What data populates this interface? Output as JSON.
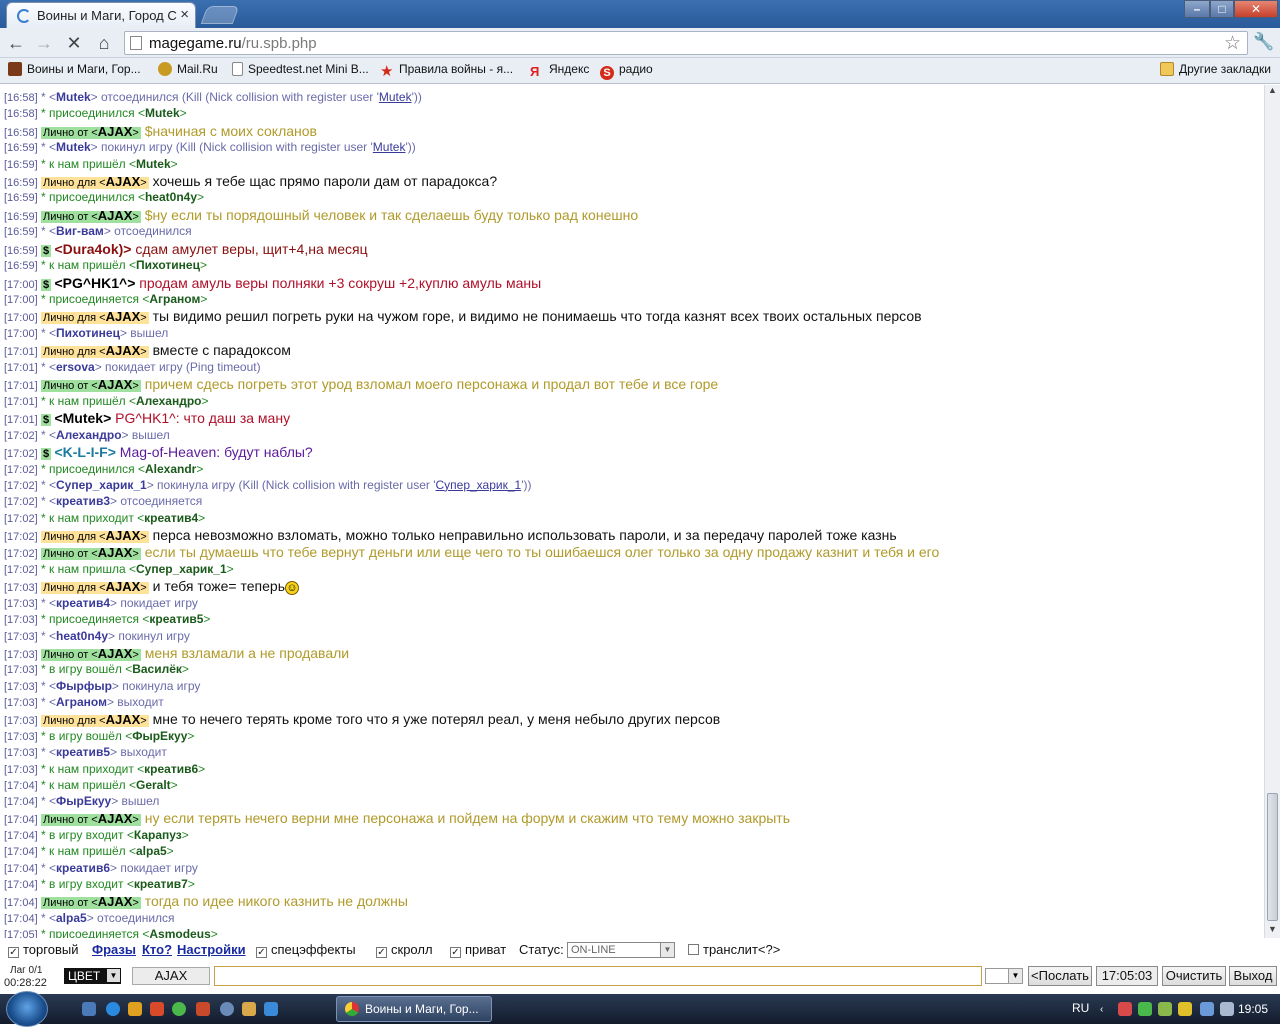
{
  "browser": {
    "tab_title": "Воины и Маги, Город Св",
    "url_domain": "magegame.ru",
    "url_path": "/ru.spb.php",
    "bookmarks": [
      {
        "label": "Воины и Маги, Гор...",
        "icon": "game-icon",
        "color": "#7a3a1a"
      },
      {
        "label": "Mail.Ru",
        "icon": "mailru-icon",
        "color": "#c89a22"
      },
      {
        "label": "Speedtest.net Mini B...",
        "icon": "page-icon",
        "color": "#ffffff"
      },
      {
        "label": "Правила войны - я...",
        "icon": "star-icon",
        "color": "#d42a1a"
      },
      {
        "label": "Яндекс",
        "icon": "yandex-icon",
        "color": "#e02020"
      },
      {
        "label": "радио",
        "icon": "radio-icon",
        "color": "#d42a1a"
      }
    ],
    "other_bookmarks": "Другие закладки"
  },
  "chat": [
    {
      "time": "[16:58]",
      "type": "leave",
      "pre": "* <",
      "nick": "Mutek",
      "post": "> отсоединился (Kill (Nick collision with register user '",
      "link": "Mutek",
      "end": "'))"
    },
    {
      "time": "[16:58]",
      "type": "sys",
      "pre": "* присоединился <",
      "nick": "Mutek",
      "post": ">"
    },
    {
      "time": "[16:58]",
      "type": "priv-from",
      "label": "Лично от <",
      "nick": "AJAX",
      "label_end": ">",
      "msg": " $начиная с моих сокланов"
    },
    {
      "time": "[16:59]",
      "type": "leave",
      "pre": "* <",
      "nick": "Mutek",
      "post": "> покинул игру (Kill (Nick collision with register user '",
      "link": "Mutek",
      "end": "'))"
    },
    {
      "time": "[16:59]",
      "type": "sys",
      "pre": "* к нам пришёл <",
      "nick": "Mutek",
      "post": ">"
    },
    {
      "time": "[16:59]",
      "type": "priv-to",
      "label": "Лично для <",
      "nick": "AJAX",
      "label_end": ">",
      "msg": " хочешь я тебе щас прямо пароли дам от парадокса?"
    },
    {
      "time": "[16:59]",
      "type": "sys",
      "pre": "* присоединился <",
      "nick": "heat0n4y",
      "post": ">"
    },
    {
      "time": "[16:59]",
      "type": "priv-from",
      "label": "Лично от <",
      "nick": "AJAX",
      "label_end": ">",
      "msg": " $ну если ты порядошный человек и так сделаешь буду только рад конешно"
    },
    {
      "time": "[16:59]",
      "type": "leave",
      "pre": "* <",
      "nick": "Виг-вам",
      "post": "> отсоединился"
    },
    {
      "time": "[16:59]",
      "type": "trade",
      "nick": "<Dura4ok)>",
      "nick_color": "#8a1010",
      "msg": " сдам амулет веры, щит+4,на месяц",
      "msg_color": "#8a1010"
    },
    {
      "time": "[16:59]",
      "type": "sys",
      "pre": "* к нам пришёл <",
      "nick": "Пихотинец",
      "post": ">"
    },
    {
      "time": "[17:00]",
      "type": "trade",
      "nick": "<PG^HK1^>",
      "nick_color": "#000000",
      "msg": " продам амуль веры полняки +3 сокруш +2,куплю амуль маны",
      "msg_color": "#b0102a"
    },
    {
      "time": "[17:00]",
      "type": "sys",
      "pre": "* присоединяется <",
      "nick": "Аграном",
      "post": ">"
    },
    {
      "time": "[17:00]",
      "type": "priv-to",
      "label": "Лично для <",
      "nick": "AJAX",
      "label_end": ">",
      "msg": " ты видимо решил погреть руки на чужом горе, и видимо не понимаешь что тогда казнят всех твоих остальных персов"
    },
    {
      "time": "[17:00]",
      "type": "leave",
      "pre": "* <",
      "nick": "Пихотинец",
      "post": "> вышел"
    },
    {
      "time": "[17:01]",
      "type": "priv-to",
      "label": "Лично для <",
      "nick": "AJAX",
      "label_end": ">",
      "msg": " вместе с парадоксом"
    },
    {
      "time": "[17:01]",
      "type": "leave",
      "pre": "* <",
      "nick": "ersova",
      "post": "> покидает игру (Ping timeout)"
    },
    {
      "time": "[17:01]",
      "type": "priv-from",
      "label": "Лично от <",
      "nick": "AJAX",
      "label_end": ">",
      "msg": " причем сдесь погреть этот урод взломал моего персонажа и продал вот тебе и все горе"
    },
    {
      "time": "[17:01]",
      "type": "sys",
      "pre": "* к нам пришёл <",
      "nick": "Алехандро",
      "post": ">"
    },
    {
      "time": "[17:01]",
      "type": "trade",
      "nick": "<Mutek>",
      "nick_color": "#000000",
      "msg": " PG^HK1^: что даш за ману",
      "msg_color": "#b0102a"
    },
    {
      "time": "[17:02]",
      "type": "leave",
      "pre": "* <",
      "nick": "Алехандро",
      "post": "> вышел"
    },
    {
      "time": "[17:02]",
      "type": "trade",
      "nick": "<K-L-I-F>",
      "nick_color": "#1a7aa0",
      "msg": " Mag-of-Heaven: будут наблы?",
      "msg_color": "#5a1a9a"
    },
    {
      "time": "[17:02]",
      "type": "sys",
      "pre": "* присоединился <",
      "nick": "Alexandr",
      "post": ">"
    },
    {
      "time": "[17:02]",
      "type": "leave",
      "pre": "* <",
      "nick": "Супер_харик_1",
      "post": "> покинула игру (Kill (Nick collision with register user '",
      "link": "Супер_харик_1",
      "end": "'))"
    },
    {
      "time": "[17:02]",
      "type": "leave",
      "pre": "* <",
      "nick": "креатив3",
      "post": "> отсоединяется"
    },
    {
      "time": "[17:02]",
      "type": "sys",
      "pre": "* к нам приходит <",
      "nick": "креатив4",
      "post": ">"
    },
    {
      "time": "[17:02]",
      "type": "priv-to",
      "label": "Лично для <",
      "nick": "AJAX",
      "label_end": ">",
      "msg": " перса невозможно взломать, можно только неправильно использовать пароли, и за передачу паролей тоже казнь"
    },
    {
      "time": "[17:02]",
      "type": "priv-from",
      "label": "Лично от <",
      "nick": "AJAX",
      "label_end": ">",
      "msg": " если ты думаешь что тебе вернут деньги или еще чего то ты ошибаешся олег только за одну продажу казнит и тебя и его"
    },
    {
      "time": "[17:02]",
      "type": "sys",
      "pre": "* к нам пришла <",
      "nick": "Супер_харик_1",
      "post": ">"
    },
    {
      "time": "[17:03]",
      "type": "priv-to",
      "label": "Лично для <",
      "nick": "AJAX",
      "label_end": ">",
      "msg": " и тебя тоже= теперь",
      "smiley": true
    },
    {
      "time": "[17:03]",
      "type": "leave",
      "pre": "* <",
      "nick": "креатив4",
      "post": "> покидает игру"
    },
    {
      "time": "[17:03]",
      "type": "sys",
      "pre": "* присоединяется <",
      "nick": "креатив5",
      "post": ">"
    },
    {
      "time": "[17:03]",
      "type": "leave",
      "pre": "* <",
      "nick": "heat0n4y",
      "post": "> покинул игру"
    },
    {
      "time": "[17:03]",
      "type": "priv-from",
      "label": "Лично от <",
      "nick": "AJAX",
      "label_end": ">",
      "msg": " меня взламали а не продавали"
    },
    {
      "time": "[17:03]",
      "type": "sys",
      "pre": "* в игру вошёл <",
      "nick": "Василёк",
      "post": ">"
    },
    {
      "time": "[17:03]",
      "type": "leave",
      "pre": "* <",
      "nick": "Фырфыр",
      "post": "> покинула игру"
    },
    {
      "time": "[17:03]",
      "type": "leave",
      "pre": "* <",
      "nick": "Аграном",
      "post": "> выходит"
    },
    {
      "time": "[17:03]",
      "type": "priv-to",
      "label": "Лично для <",
      "nick": "AJAX",
      "label_end": ">",
      "msg": " мне то нечего терять кроме того что я уже потерял реал, у меня небыло других персов"
    },
    {
      "time": "[17:03]",
      "type": "sys",
      "pre": "* в игру вошёл <",
      "nick": "ФырЕкуу",
      "post": ">"
    },
    {
      "time": "[17:03]",
      "type": "leave",
      "pre": "* <",
      "nick": "креатив5",
      "post": "> выходит"
    },
    {
      "time": "[17:03]",
      "type": "sys",
      "pre": "* к нам приходит <",
      "nick": "креатив6",
      "post": ">"
    },
    {
      "time": "[17:04]",
      "type": "sys",
      "pre": "* к нам пришёл <",
      "nick": "Geralt",
      "post": ">"
    },
    {
      "time": "[17:04]",
      "type": "leave",
      "pre": "* <",
      "nick": "ФырЕкуу",
      "post": "> вышел"
    },
    {
      "time": "[17:04]",
      "type": "priv-from",
      "label": "Лично от <",
      "nick": "AJAX",
      "label_end": ">",
      "msg": " ну если терять нечего верни мне персонажа и пойдем на форум и скажим что тему можно закрыть"
    },
    {
      "time": "[17:04]",
      "type": "sys",
      "pre": "* в игру входит <",
      "nick": "Карапуз",
      "post": ">"
    },
    {
      "time": "[17:04]",
      "type": "sys",
      "pre": "* к нам пришёл <",
      "nick": "alpa5",
      "post": ">"
    },
    {
      "time": "[17:04]",
      "type": "leave",
      "pre": "* <",
      "nick": "креатив6",
      "post": "> покидает игру"
    },
    {
      "time": "[17:04]",
      "type": "sys",
      "pre": "* в игру входит <",
      "nick": "креатив7",
      "post": ">"
    },
    {
      "time": "[17:04]",
      "type": "priv-from",
      "label": "Лично от <",
      "nick": "AJAX",
      "label_end": ">",
      "msg": " тогда по идее никого казнить не должны"
    },
    {
      "time": "[17:04]",
      "type": "leave",
      "pre": "* <",
      "nick": "alpa5",
      "post": "> отсоединился"
    },
    {
      "time": "[17:05]",
      "type": "sys",
      "pre": "* присоединяется <",
      "nick": "Asmodeus",
      "post": ">"
    }
  ],
  "controls": {
    "trade_label": "торговый",
    "phrases": "Фразы",
    "who": "Кто?",
    "settings": "Настройки",
    "effects_label": "спецэффекты",
    "scroll_label": "скролл",
    "private_label": "приват",
    "status_label": "Статус:",
    "status_value": "ON-LINE",
    "translit_label": "транслит",
    "translit_help": "<?>"
  },
  "inputbar": {
    "lag": "Лаг 0/1",
    "session_time": "00:28:22",
    "color_label": "ЦВЕТ",
    "nick": "AJAX",
    "send": "<Послать",
    "time": "17:05:03",
    "clear": "Очистить",
    "exit": "Выход"
  },
  "taskbar": {
    "window_title": "Воины и Маги, Гор...",
    "lang": "RU",
    "time": "19:05"
  }
}
